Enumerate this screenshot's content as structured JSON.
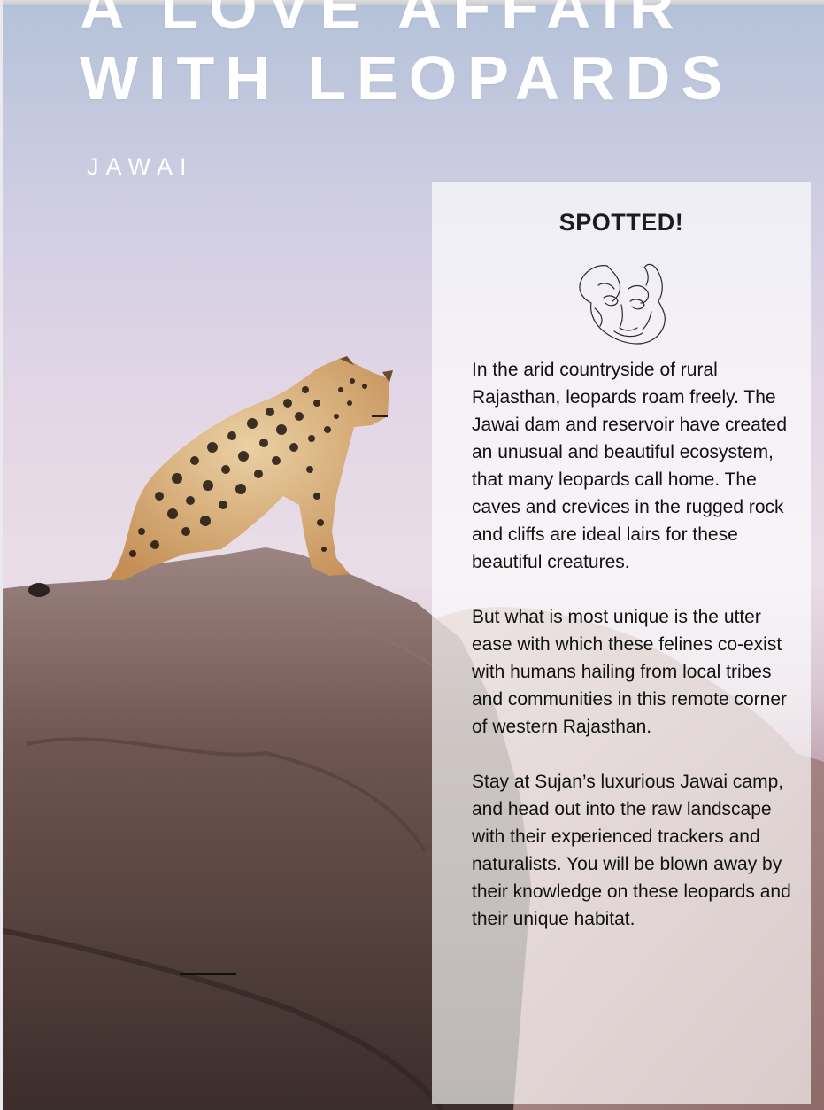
{
  "headline": {
    "line1": "A LOVE AFFAIR",
    "line2": "WITH LEOPARDS"
  },
  "kicker": "JAWAI",
  "panel": {
    "title": "SPOTTED!",
    "sketch_icon": "leopard-line-sketch-icon",
    "paragraphs": [
      "In the arid countryside of rural Rajasthan, leopards roam freely. The Jawai dam and reservoir have created an unusual and beautiful ecosystem, that many leopards call home. The caves and crevices in the rugged rock and cliffs are ideal lairs for these beautiful creatures.",
      "But what is most unique is the utter ease with which these felines co-exist with humans hailing from local tribes and communities in this remote corner of western Rajasthan.",
      "Stay at Sujan’s luxurious Jawai camp, and head out into the raw landscape with their experienced trackers and naturalists. You will be blown away by their knowledge on these leopards and their unique habitat."
    ]
  },
  "colors": {
    "sky_top": "#b3c2d9",
    "sky_mid": "#e9dde7",
    "rock": "#6f5650",
    "leopard_coat": "#d6a66a",
    "text": "#111111",
    "headline": "#ffffff"
  }
}
